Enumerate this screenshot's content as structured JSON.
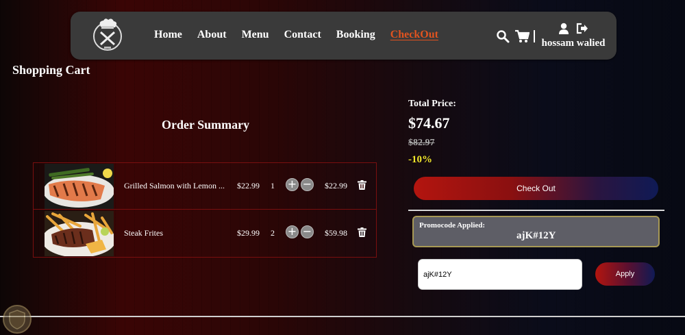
{
  "nav": {
    "links": [
      "Home",
      "About",
      "Menu",
      "Contact",
      "Booking",
      "CheckOut"
    ],
    "user_name": "hossam walied"
  },
  "page_title": "Shopping Cart",
  "summary": {
    "title": "Order Summary",
    "items": [
      {
        "name": "Grilled Salmon with Lemon ...",
        "price": "$22.99",
        "qty": "1",
        "total": "$22.99"
      },
      {
        "name": "Steak Frites",
        "price": "$29.99",
        "qty": "2",
        "total": "$59.98"
      }
    ]
  },
  "totals": {
    "label": "Total Price:",
    "price": "$74.67",
    "old_price": "$82.97",
    "discount": "-10%"
  },
  "checkout_label": "Check Out",
  "promo": {
    "applied_label": "Promocode Applied:",
    "code": "ajK#12Y",
    "input_value": "ajK#12Y",
    "apply_label": "Apply"
  },
  "icons": [
    "chef-logo-icon",
    "search-icon",
    "cart-icon",
    "user-icon",
    "logout-icon",
    "plus-icon",
    "minus-icon",
    "trash-icon"
  ],
  "colors": {
    "accent": "#e0531f",
    "discount": "#f0e62a",
    "nav_bg": "#3a3a3a"
  }
}
